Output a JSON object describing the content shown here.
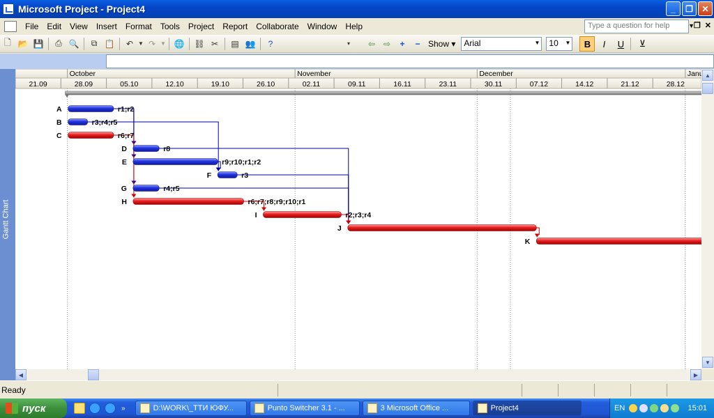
{
  "window": {
    "title": "Microsoft Project - Project4"
  },
  "menu": {
    "items": [
      "File",
      "Edit",
      "View",
      "Insert",
      "Format",
      "Tools",
      "Project",
      "Report",
      "Collaborate",
      "Window",
      "Help"
    ],
    "help_placeholder": "Type a question for help"
  },
  "toolbar": {
    "show_label": "Show",
    "font_name": "Arial",
    "font_size": "10",
    "bold": "B",
    "italic": "I",
    "underline": "U",
    "icons": [
      "new-icon",
      "open-icon",
      "save-icon",
      "print-icon",
      "print-preview-icon",
      "copy-icon",
      "paste-icon",
      "undo-icon",
      "redo-icon",
      "hyperlink-icon",
      "link-tasks-icon",
      "unlink-tasks-icon",
      "task-info-icon",
      "assign-resources-icon",
      "help-icon"
    ]
  },
  "viewbar": {
    "label": "Gantt Chart"
  },
  "timescale": {
    "months": [
      {
        "label": "October",
        "start": "2008-09-29"
      },
      {
        "label": "November",
        "start": "2008-11-03"
      },
      {
        "label": "December",
        "start": "2008-12-01"
      },
      {
        "label": "Janua",
        "start": "2009-01-02"
      }
    ],
    "weeks": [
      "21.09",
      "28.09",
      "05.10",
      "12.10",
      "19.10",
      "26.10",
      "02.11",
      "09.11",
      "16.11",
      "23.11",
      "30.11",
      "07.12",
      "14.12",
      "21.12",
      "28.12"
    ]
  },
  "tasks": [
    {
      "name": "A",
      "start": "2008-09-29",
      "finish": "2008-10-06",
      "critical": false,
      "resources": "r1;r2",
      "successors": [
        "D",
        "E",
        "G"
      ]
    },
    {
      "name": "B",
      "start": "2008-09-29",
      "finish": "2008-10-02",
      "critical": false,
      "resources": "r3;r4;r5",
      "successors": [
        "F"
      ]
    },
    {
      "name": "C",
      "start": "2008-09-29",
      "finish": "2008-10-06",
      "critical": true,
      "resources": "r6;r7",
      "successors": [
        "H"
      ]
    },
    {
      "name": "D",
      "start": "2008-10-09",
      "finish": "2008-10-13",
      "critical": false,
      "resources": "r8",
      "successors": [
        "J"
      ]
    },
    {
      "name": "E",
      "start": "2008-10-09",
      "finish": "2008-10-22",
      "critical": false,
      "resources": "r9;r10;r1;r2",
      "successors": [
        "F"
      ]
    },
    {
      "name": "F",
      "start": "2008-10-22",
      "finish": "2008-10-25",
      "critical": false,
      "resources": "r3",
      "successors": [
        "J"
      ]
    },
    {
      "name": "G",
      "start": "2008-10-09",
      "finish": "2008-10-13",
      "critical": false,
      "resources": "r4;r5",
      "successors": [
        "J"
      ]
    },
    {
      "name": "H",
      "start": "2008-10-09",
      "finish": "2008-10-26",
      "critical": true,
      "resources": "r6;r7;r8;r9;r10;r1",
      "successors": [
        "I"
      ]
    },
    {
      "name": "I",
      "start": "2008-10-29",
      "finish": "2008-11-10",
      "critical": true,
      "resources": "r2;r3;r4",
      "successors": [
        "J"
      ]
    },
    {
      "name": "J",
      "start": "2008-11-11",
      "finish": "2008-12-10",
      "critical": true,
      "resources": "",
      "successors": [
        "K"
      ]
    },
    {
      "name": "K",
      "start": "2008-12-10",
      "finish": "2009-02-08",
      "critical": true,
      "resources": "",
      "successors": []
    }
  ],
  "project_summary": {
    "start": "2008-09-29",
    "finish": "2009-02-08"
  },
  "colors": {
    "noncritical": "#1F2FD8",
    "critical": "#E02020",
    "link": "#0000AA",
    "critical_link": "#D00000"
  },
  "status": {
    "text": "Ready"
  },
  "taskbar": {
    "start_label": "пуск",
    "items": [
      {
        "label": "D:\\WORK\\_ТТИ ЮФУ...",
        "active": false
      },
      {
        "label": "Punto Switcher 3.1 - ...",
        "active": false
      },
      {
        "label": "3 Microsoft Office ...",
        "active": false
      },
      {
        "label": "Project4",
        "active": true
      }
    ],
    "lang": "EN",
    "clock": "15:01"
  }
}
